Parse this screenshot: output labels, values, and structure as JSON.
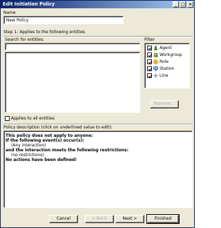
{
  "window": {
    "title": "Edit Initiation Policy",
    "minimize_glyph": "_",
    "maximize_glyph": "□",
    "close_glyph": "×"
  },
  "name_section": {
    "label": "Name",
    "value": "New Policy"
  },
  "step1": {
    "heading": "Step 1: Applies to the following entities",
    "search_label": "Search for entities:",
    "search_value": "",
    "applies_all_label": "Applies to all entities",
    "applies_all_checked": false
  },
  "filter": {
    "label": "Filter",
    "items": [
      {
        "label": "Agent",
        "checked": true,
        "icon": "agent-icon",
        "color": "#3a7a2a"
      },
      {
        "label": "Workgroup",
        "checked": true,
        "icon": "workgroup-icon",
        "color": "#c07020"
      },
      {
        "label": "Role",
        "checked": true,
        "icon": "role-icon",
        "color": "#d08a10"
      },
      {
        "label": "Station",
        "checked": true,
        "icon": "station-icon",
        "color": "#2a6ab0"
      },
      {
        "label": "Line",
        "checked": true,
        "icon": "line-icon",
        "color": "#5a5a9a"
      }
    ],
    "remove_label": "Remove..."
  },
  "description": {
    "heading": "Policy description (click on underlined value to edit):",
    "lines": [
      "This policy does not apply to anyone:",
      "If the following event(s) occur(s):",
      "(Any interaction)",
      "and the interaction meets the following restrictions:",
      "(no restrictions)",
      "No actions have been defined!"
    ]
  },
  "footer": {
    "cancel_label": "Cancel",
    "back_label": "< Back",
    "next_label": "Next >",
    "finished_label": "Finished"
  }
}
